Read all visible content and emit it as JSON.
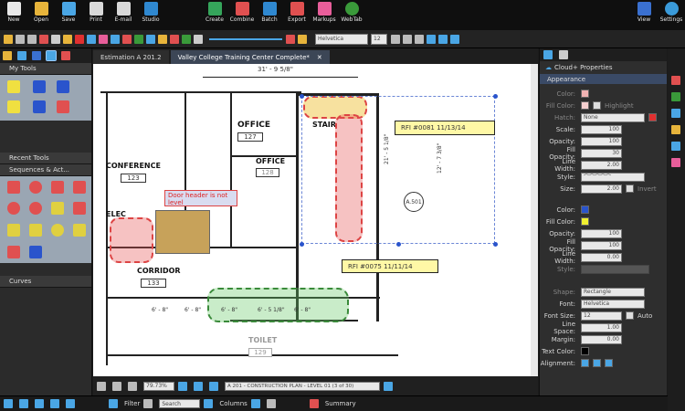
{
  "ribbon": {
    "items": [
      {
        "label": "New",
        "color": "#e8e8e8"
      },
      {
        "label": "Open",
        "color": "#e7b43b"
      },
      {
        "label": "Save",
        "color": "#4aa6e5"
      },
      {
        "label": "Print",
        "color": "#d9d9d9"
      },
      {
        "label": "E-mail",
        "color": "#d9d9d9"
      },
      {
        "label": "Studio",
        "color": "#2f88d0"
      },
      {
        "label": "Create",
        "color": "#35a55b"
      },
      {
        "label": "Combine",
        "color": "#e05050"
      },
      {
        "label": "Batch",
        "color": "#2f88d0"
      },
      {
        "label": "Export",
        "color": "#e05050"
      },
      {
        "label": "Markups",
        "color": "#e85e9a"
      },
      {
        "label": "WebTab",
        "color": "#3a9a3a"
      },
      {
        "label": "View",
        "color": "#3a70d0"
      },
      {
        "label": "Settings",
        "color": "#3a9ad9"
      }
    ]
  },
  "toolbar": {
    "font": "Helvetica",
    "size": "12"
  },
  "left": {
    "my_tools": "My Tools",
    "recent_tools": "Recent Tools",
    "sequences": "Sequences & Act...",
    "curves": "Curves"
  },
  "tabs": [
    {
      "label": "Estimation A 201.2"
    },
    {
      "label": "Valley College Training Center Complete*"
    }
  ],
  "drawing": {
    "dim_top": "31' - 9 5/8\"",
    "rooms": [
      {
        "name": "OFFICE",
        "num": "127"
      },
      {
        "name": "OFFICE",
        "num": "128"
      },
      {
        "name": "STAIR",
        "num": ""
      },
      {
        "name": "CONFERENCE",
        "num": "123"
      },
      {
        "name": "ELEC",
        "num": ""
      },
      {
        "name": "CORRIDOR",
        "num": "133"
      },
      {
        "name": "TOILET",
        "num": "129"
      }
    ],
    "rfi1": "RFI #0081 11/13/14",
    "rfi2": "RFI #0075 11/11/14",
    "note": "Door header is not level",
    "dim_side": "21' - 5 1/8\"",
    "dim_side2": "12' - 7 3/8\"",
    "tag_a": "A.501",
    "dims_bottom": [
      "6' - 8\"",
      "6' - 8\"",
      "6' - 8\"",
      "6' - 5 1/8\"",
      "6' - 8\""
    ]
  },
  "status": {
    "zoom": "79.73%",
    "page": "A 201 - CONSTRUCTION PLAN - LEVEL 01 (3 of 30)"
  },
  "bottom": {
    "filter": "Filter",
    "search": "Search",
    "columns": "Columns",
    "summary": "Summary"
  },
  "props": {
    "title": "Cloud+ Properties",
    "section": "Appearance",
    "rows": [
      {
        "label": "Color:",
        "value": ""
      },
      {
        "label": "Fill Color:",
        "value": "Highlight"
      },
      {
        "label": "Hatch:",
        "value": "None"
      },
      {
        "label": "Scale:",
        "value": "100"
      },
      {
        "label": "Opacity:",
        "value": "100"
      },
      {
        "label": "Fill Opacity:",
        "value": "30"
      },
      {
        "label": "Line Width:",
        "value": "2.00"
      },
      {
        "label": "Style:",
        "value": ""
      },
      {
        "label": "Size:",
        "value": "2.00"
      },
      {
        "label": "Invert",
        "value": ""
      },
      {
        "label": "Color:",
        "value": ""
      },
      {
        "label": "Fill Color:",
        "value": ""
      },
      {
        "label": "Opacity:",
        "value": "100"
      },
      {
        "label": "Fill Opacity:",
        "value": "100"
      },
      {
        "label": "Line Width:",
        "value": "0.00"
      },
      {
        "label": "Style:",
        "value": ""
      },
      {
        "label": "Shape:",
        "value": "Rectangle"
      },
      {
        "label": "Font:",
        "value": "Helvetica"
      },
      {
        "label": "Font Size:",
        "value": "12"
      },
      {
        "label": "Auto",
        "value": ""
      },
      {
        "label": "Line Space:",
        "value": "1.00"
      },
      {
        "label": "Margin:",
        "value": "0.00"
      },
      {
        "label": "Text Color:",
        "value": ""
      },
      {
        "label": "Alignment:",
        "value": ""
      }
    ]
  },
  "colors": {
    "accent": "#3c4656",
    "cloud_red": "#d44444",
    "cloud_green": "#3a8a3a",
    "callout": "#fff8a6"
  }
}
